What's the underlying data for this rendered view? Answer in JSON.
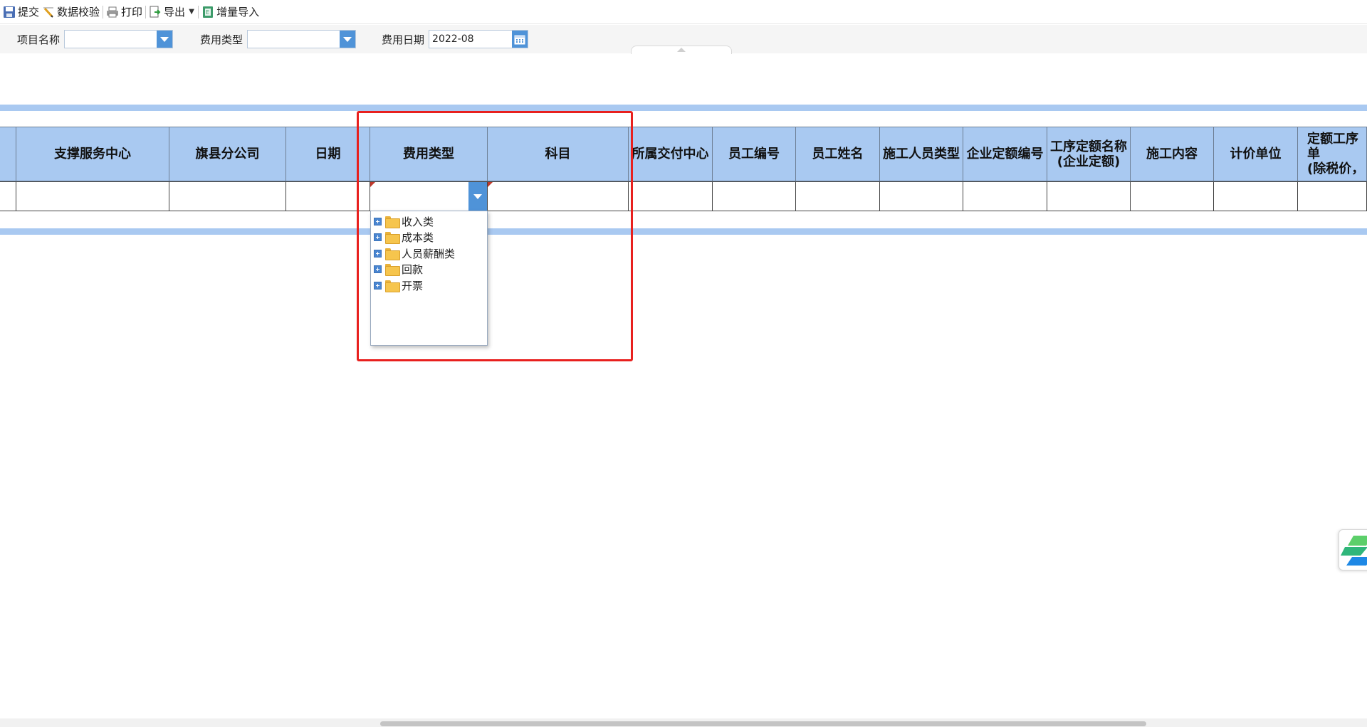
{
  "toolbar": {
    "submit": "提交",
    "validate": "数据校验",
    "print": "打印",
    "export": "导出",
    "incremental_import": "增量导入"
  },
  "filters": {
    "project_name_label": "项目名称",
    "project_name_value": "",
    "expense_type_label": "费用类型",
    "expense_type_value": "",
    "expense_date_label": "费用日期",
    "expense_date_value": "2022-08"
  },
  "grid": {
    "columns": [
      "",
      "支撑服务中心",
      "旗县分公司",
      "日期",
      "费用类型",
      "科目",
      "所属交付中心",
      "员工编号",
      "员工姓名",
      "施工人员类型",
      "企业定额编号",
      "工序定额名称\n(企业定额)",
      "施工内容",
      "计价单位",
      "定额工序单\n(除税价，"
    ]
  },
  "dropdown_tree": {
    "items": [
      "收入类",
      "成本类",
      "人员薪酬类",
      "回款",
      "开票"
    ]
  },
  "colors": {
    "header_blue": "#a9c9f1",
    "accent_blue": "#4f93d8",
    "highlight_red": "#e8201e"
  },
  "icons": [
    "save-icon",
    "validate-pencil-icon",
    "print-icon",
    "export-icon",
    "excel-import-icon",
    "calendar-icon",
    "folder-icon",
    "expand-plus-icon"
  ]
}
